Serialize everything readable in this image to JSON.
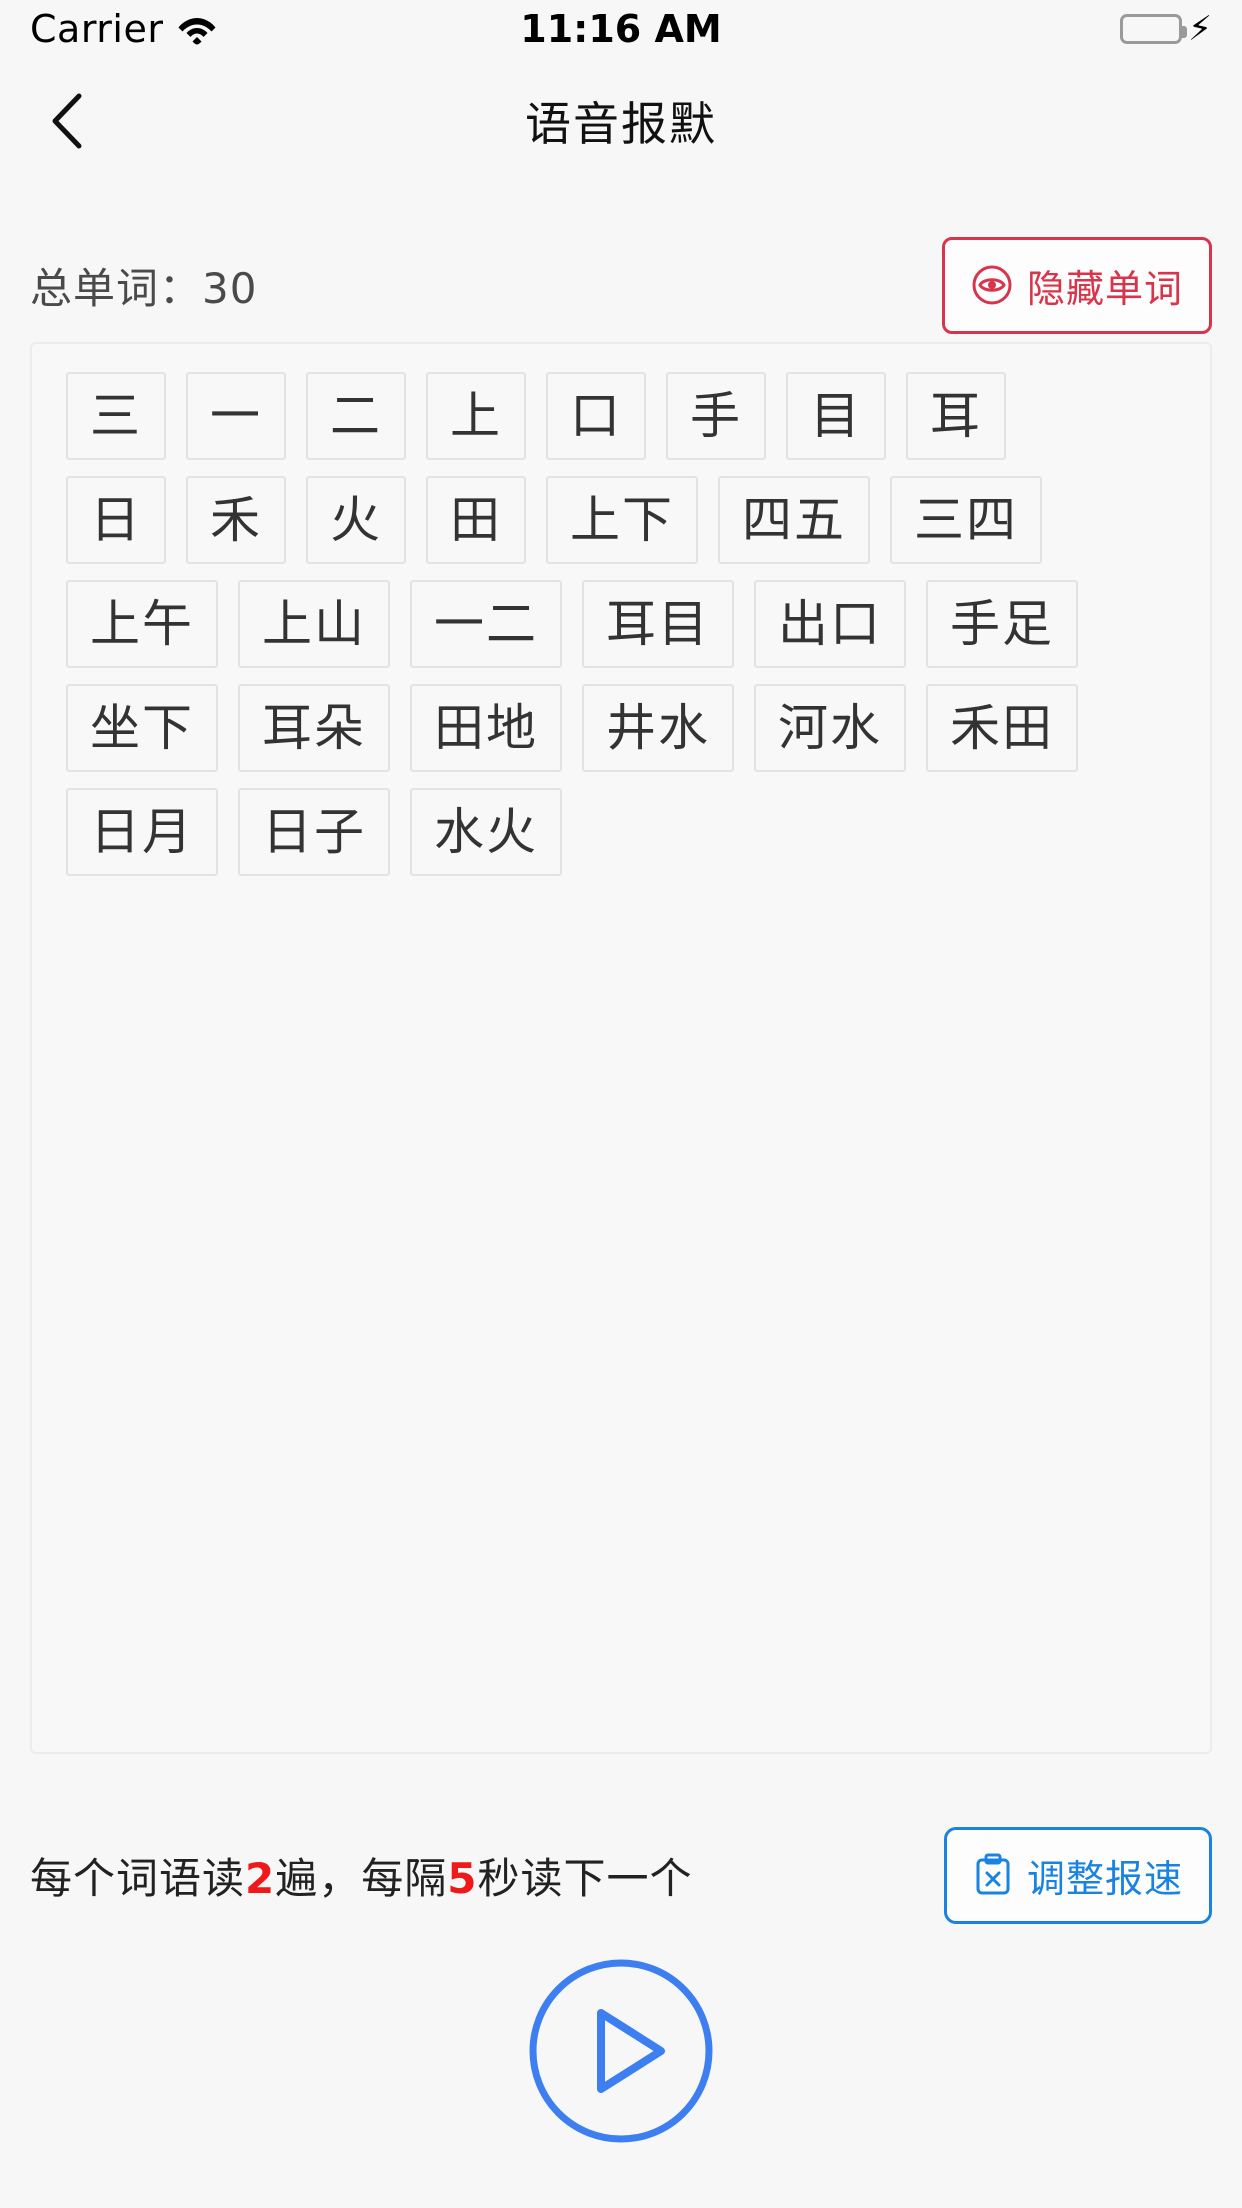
{
  "statusbar": {
    "carrier": "Carrier",
    "wifi_icon": "wifi-icon",
    "time": "11:16 AM",
    "battery_icon": "battery-icon",
    "charging_icon": "lightning-bolt-icon",
    "battery_color": "#4cd964"
  },
  "navbar": {
    "back_icon": "chevron-left-icon",
    "title": "语音报默"
  },
  "header": {
    "total_words_label": "总单词：30",
    "hide_button": {
      "icon": "eye-icon",
      "label": "隐藏单词",
      "color": "#d8344b"
    }
  },
  "word_card": {
    "rows": [
      [
        "三",
        "一",
        "二",
        "上",
        "口",
        "手",
        "目",
        "耳"
      ],
      [
        "日",
        "禾",
        "火",
        "田",
        "上下",
        "四五",
        "三四"
      ],
      [
        "上午",
        "上山",
        "一二",
        "耳目",
        "出口",
        "手足"
      ],
      [
        "坐下",
        "耳朵",
        "田地",
        "井水",
        "河水",
        "禾田"
      ],
      [
        "日月",
        "日子",
        "水火"
      ]
    ]
  },
  "footer": {
    "speed_note": {
      "part1": "每个词语读",
      "repeat_count": "2",
      "part2": "遍，每隔",
      "interval_seconds": "5",
      "part3": "秒读下一个"
    },
    "adjust_button": {
      "icon": "clipboard-x-icon",
      "label": "调整报速",
      "color": "#1a83e0"
    },
    "play_button": {
      "icon": "play-circle-icon",
      "color": "#3d7ff0"
    }
  }
}
